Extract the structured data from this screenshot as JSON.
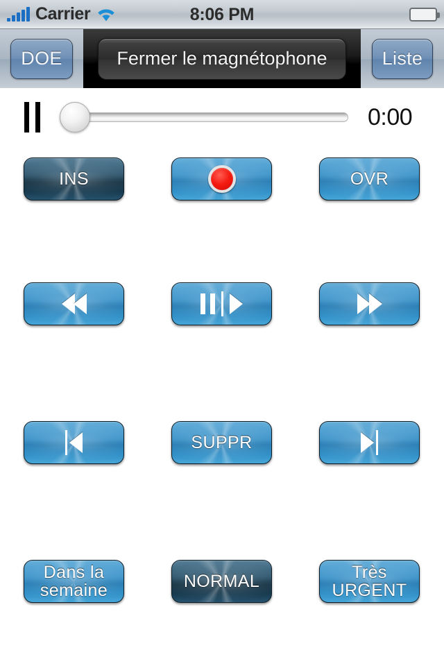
{
  "statusbar": {
    "carrier": "Carrier",
    "time": "8:06 PM",
    "signal_icon": "signal-bars-icon",
    "wifi_icon": "wifi-icon",
    "battery_icon": "battery-full-icon",
    "battery_color": "#63c41b"
  },
  "navbar": {
    "left_button": "DOE",
    "title_button": "Fermer le magnétophone",
    "right_button": "Liste"
  },
  "transport": {
    "state_icon": "pause-icon",
    "slider_value": 0,
    "slider_min": 0,
    "slider_max": 100,
    "time_label": "0:00"
  },
  "colors": {
    "button_light": "#2f8cc6",
    "button_dark": "#16394e",
    "record_red": "#f51b11",
    "nav_blue": "#6f90b6"
  },
  "grid": {
    "rows": [
      [
        {
          "name": "ins-button",
          "label": "INS",
          "style": "dark",
          "icon": null
        },
        {
          "name": "record-button",
          "label": "",
          "style": "light",
          "icon": "record-icon"
        },
        {
          "name": "ovr-button",
          "label": "OVR",
          "style": "light",
          "icon": null
        }
      ],
      [
        {
          "name": "rewind-button",
          "label": "",
          "style": "light",
          "icon": "rewind-icon"
        },
        {
          "name": "pause-play-button",
          "label": "",
          "style": "light",
          "icon": "pause-play-icon"
        },
        {
          "name": "fast-forward-button",
          "label": "",
          "style": "light",
          "icon": "fast-forward-icon"
        }
      ],
      [
        {
          "name": "skip-to-start-button",
          "label": "",
          "style": "light",
          "icon": "skip-start-icon"
        },
        {
          "name": "suppr-button",
          "label": "SUPPR",
          "style": "light",
          "icon": null
        },
        {
          "name": "skip-to-end-button",
          "label": "",
          "style": "light",
          "icon": "skip-end-icon"
        }
      ],
      [
        {
          "name": "priority-week-button",
          "label": "Dans la\nsemaine",
          "style": "light",
          "icon": null
        },
        {
          "name": "priority-normal-button",
          "label": "NORMAL",
          "style": "dark",
          "icon": null
        },
        {
          "name": "priority-very-urgent-button",
          "label": "Très\nURGENT",
          "style": "light",
          "icon": null
        }
      ]
    ]
  }
}
